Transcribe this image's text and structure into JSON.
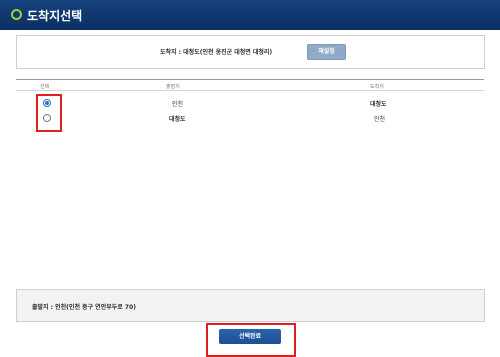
{
  "window": {
    "title": "도착지선택"
  },
  "arrival": {
    "label": "도착지 : 대청도(인천 옹진군 대청면 대청리)"
  },
  "reset_button": {
    "label": "재설정"
  },
  "table": {
    "columns": [
      "선택",
      "출발지",
      "도착지"
    ],
    "rows": [
      {
        "selected": true,
        "origin": "인천",
        "destination": "대청도"
      },
      {
        "selected": false,
        "origin": "대청도",
        "destination": "인천"
      }
    ]
  },
  "departure": {
    "label": "출발지 : 인천(인천 중구 연안부두로 70)"
  },
  "confirm_button": {
    "label": "선택완료"
  },
  "colors": {
    "titlebar": "#0b2f63",
    "button": "#1d4f94",
    "highlight": "#e02020"
  }
}
